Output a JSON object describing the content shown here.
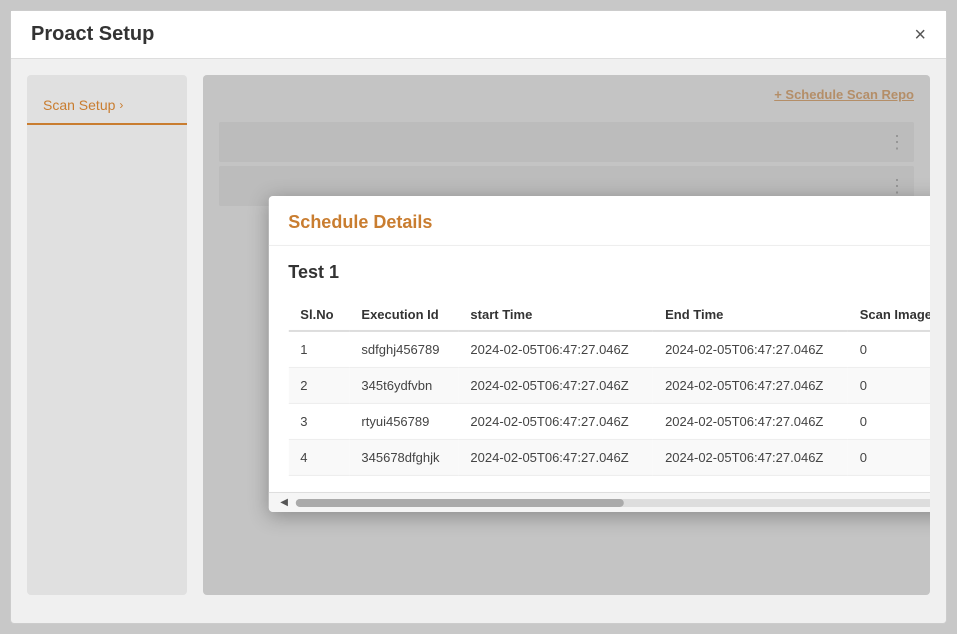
{
  "app": {
    "title": "Proact Setup",
    "close_label": "×"
  },
  "sidebar": {
    "items": [
      {
        "label": "Scan Setup",
        "chevron": "›"
      }
    ]
  },
  "toolbar": {
    "schedule_scan_label": "+ Schedule Scan Repo"
  },
  "modal": {
    "title": "Schedule Details",
    "close_label": "×",
    "subtitle": "Test 1",
    "table": {
      "columns": [
        "Sl.No",
        "Execution Id",
        "start Time",
        "End Time",
        "Scan Images"
      ],
      "rows": [
        {
          "slno": "1",
          "exec_id": "sdfghj456789",
          "start_time": "2024-02-05T06:47:27.046Z",
          "end_time": "2024-02-05T06:47:27.046Z",
          "scan_images": "0"
        },
        {
          "slno": "2",
          "exec_id": "345t6ydfvbn",
          "start_time": "2024-02-05T06:47:27.046Z",
          "end_time": "2024-02-05T06:47:27.046Z",
          "scan_images": "0"
        },
        {
          "slno": "3",
          "exec_id": "rtyui456789",
          "start_time": "2024-02-05T06:47:27.046Z",
          "end_time": "2024-02-05T06:47:27.046Z",
          "scan_images": "0"
        },
        {
          "slno": "4",
          "exec_id": "345678dfghjk",
          "start_time": "2024-02-05T06:47:27.046Z",
          "end_time": "2024-02-05T06:47:27.046Z",
          "scan_images": "0"
        }
      ]
    }
  },
  "colors": {
    "accent": "#c97d30",
    "text_dark": "#333",
    "text_muted": "#888"
  }
}
